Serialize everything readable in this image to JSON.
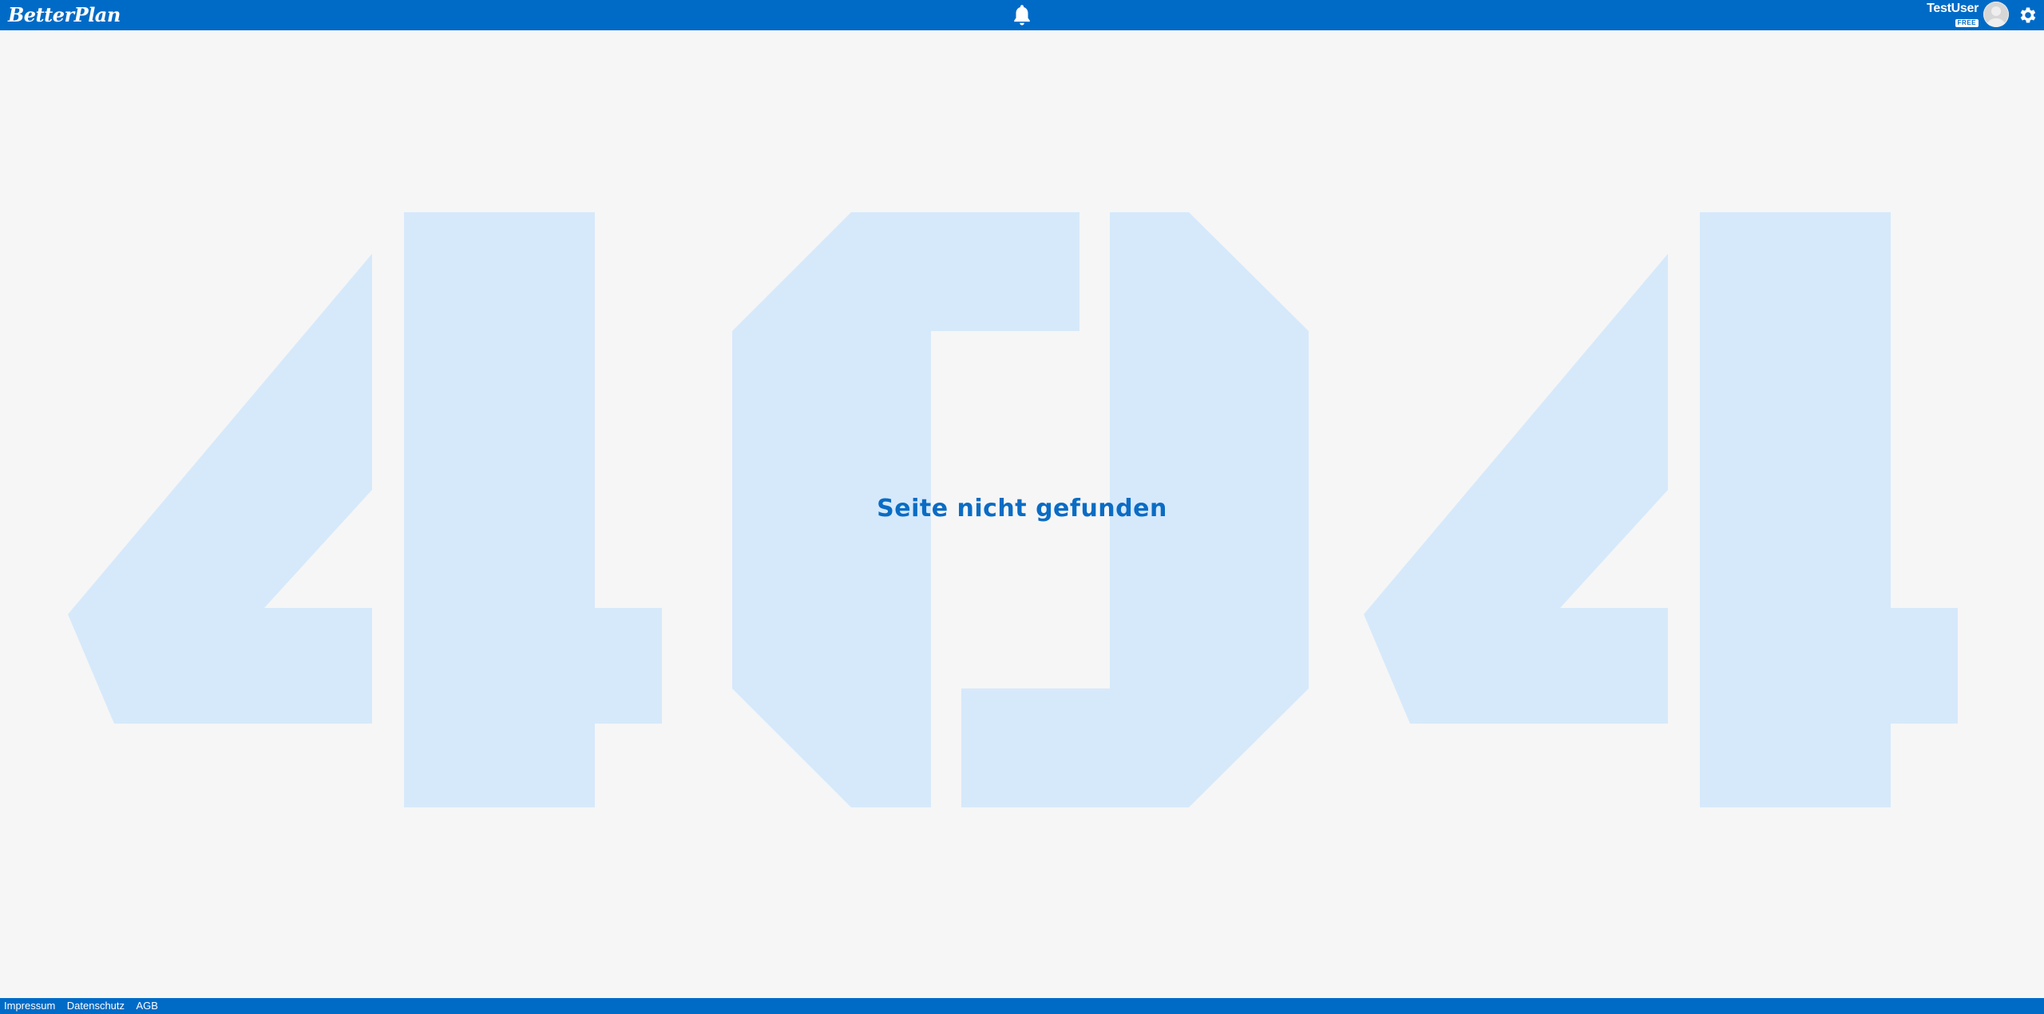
{
  "header": {
    "app_name": "BetterPlan",
    "user_name": "TestUser",
    "plan_badge": "FREE",
    "notifications_icon": "bell-icon",
    "settings_icon": "gear-icon",
    "avatar_icon": "user-avatar"
  },
  "main": {
    "background_number": "404",
    "message": "Seite nicht gefunden"
  },
  "footer": {
    "links": [
      {
        "label": "Impressum"
      },
      {
        "label": "Datenschutz"
      },
      {
        "label": "AGB"
      }
    ]
  },
  "colors": {
    "brand": "#006bc7",
    "background": "#f6f6f6",
    "number_fill": "#d6e9fb",
    "message_text": "#0a6cc4"
  }
}
